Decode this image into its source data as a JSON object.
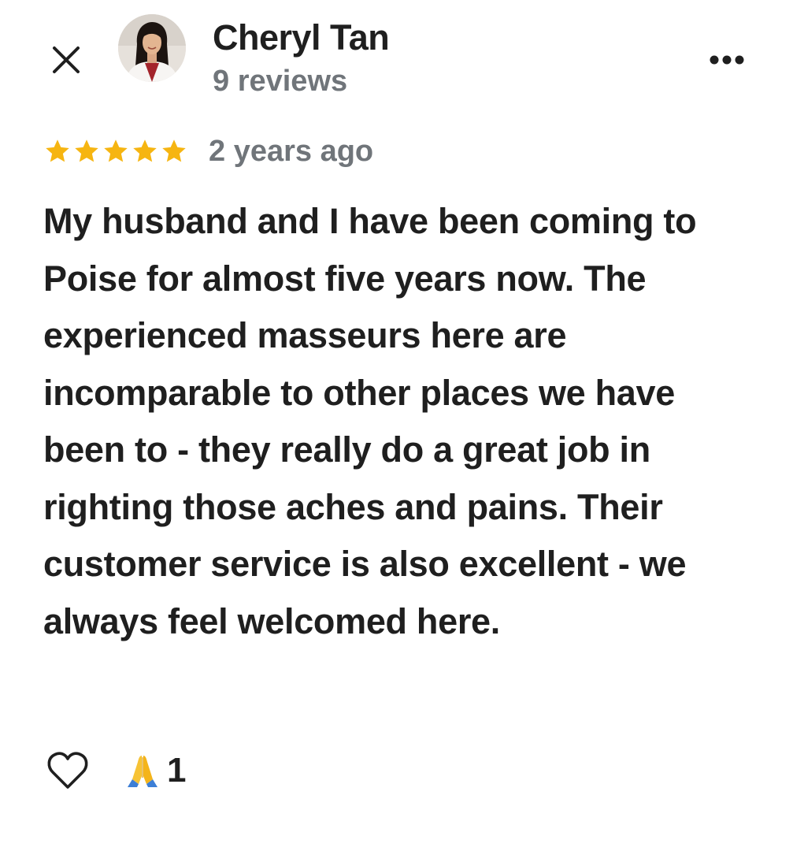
{
  "review": {
    "author_name": "Cheryl Tan",
    "author_reviews": "9 reviews",
    "rating": 5,
    "rating_max": 5,
    "time_ago": "2 years ago",
    "text": "My husband and I have been coming to Poise for almost five years now. The experienced masseurs here are incomparable to other places we have been to - they really do a great job in righting those aches and pains. Their customer service is also excellent - we always feel welcomed here.",
    "reaction_count": "1"
  },
  "icons": {
    "close": "close-icon",
    "more": "more-options-icon",
    "star": "star-icon",
    "like": "heart-icon",
    "reaction": "praying-hands-icon"
  },
  "colors": {
    "star": "#f6b511",
    "text": "#1f1f1f",
    "secondary_text": "#70757a"
  }
}
